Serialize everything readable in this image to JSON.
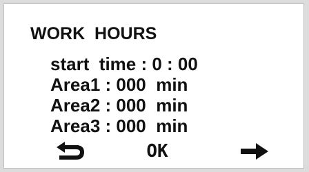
{
  "screen": {
    "title": "WORK  HOURS",
    "lines": [
      "start  time : 0 : 00",
      "Area1 : 000  min",
      "Area2 : 000  min",
      "Area3 : 000  min"
    ]
  },
  "footer": {
    "back_icon": "return-arrow-icon",
    "ok_label": "OK",
    "next_icon": "right-arrow-icon"
  },
  "colors": {
    "background": "#ffffff",
    "text": "#111111",
    "frame": "#dcdcdc"
  }
}
